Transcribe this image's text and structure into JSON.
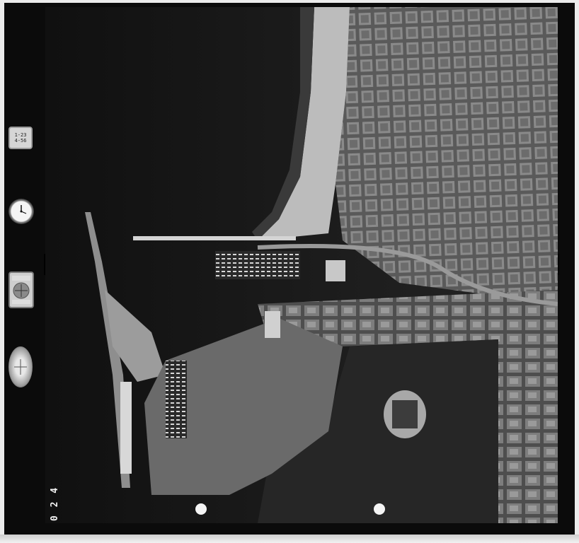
{
  "image": {
    "type": "aerial-photograph",
    "tone": "black-and-white",
    "frame_number": "0 2 4"
  },
  "instruments": {
    "counter_text": [
      "1-23",
      "4-56"
    ],
    "icons": [
      "counter-display",
      "clock-dial",
      "altimeter-dial",
      "level-bubble"
    ]
  },
  "scene": {
    "regions": [
      "sea",
      "beach",
      "city-grid",
      "harbor",
      "breakwater",
      "marina",
      "stadium",
      "park"
    ]
  },
  "colors": {
    "film_border": "#0b0b0b",
    "sea": "#161616",
    "beach": "#bdbdbd",
    "city": "#6f6f6f",
    "park": "#2b2b2b"
  }
}
